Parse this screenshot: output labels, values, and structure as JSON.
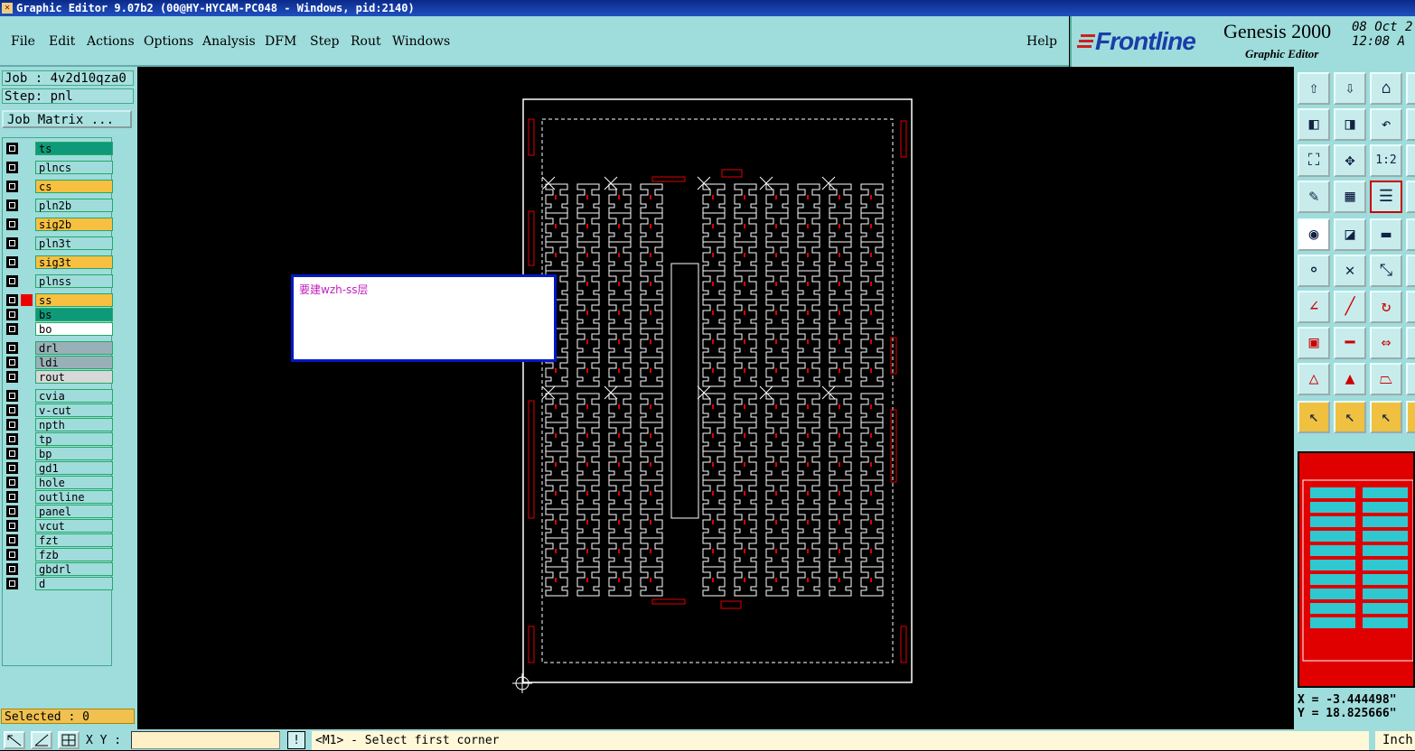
{
  "window": {
    "title": "Graphic Editor 9.07b2 (00@HY-HYCAM-PC048 - Windows, pid:2140)"
  },
  "menu": [
    "File",
    "Edit",
    "Actions",
    "Options",
    "Analysis",
    "DFM",
    "Step",
    "Rout",
    "Windows"
  ],
  "help_label": "Help",
  "brand": {
    "logo": "Frontline",
    "product": "Genesis 2000",
    "subtitle": "Graphic Editor",
    "date": "08 Oct 2",
    "time": "12:08 A"
  },
  "job": {
    "job_label": "Job : 4v2d10qza0",
    "step_label": "Step: pnl",
    "job_matrix_button": "Job Matrix ..."
  },
  "layers": [
    {
      "name": "ts",
      "color": "#0e9a78"
    },
    {
      "name": "plncs",
      "color": "#a0dcdc"
    },
    {
      "name": "cs",
      "color": "#f8c040"
    },
    {
      "name": "pln2b",
      "color": "#a0dcdc"
    },
    {
      "name": "sig2b",
      "color": "#f8c040"
    },
    {
      "name": "pln3t",
      "color": "#a0dcdc"
    },
    {
      "name": "sig3t",
      "color": "#f8c040"
    },
    {
      "name": "plnss",
      "color": "#a0dcdc"
    },
    {
      "name": "ss",
      "color": "#f8c040",
      "active": true
    },
    {
      "name": "bs",
      "color": "#0e9a78"
    },
    {
      "name": "bo",
      "color": "#ffffff"
    },
    {
      "name": "drl",
      "color": "#9ab0b8"
    },
    {
      "name": "ldi",
      "color": "#9ab0b8"
    },
    {
      "name": "rout",
      "color": "#d8d8d8"
    },
    {
      "name": "cvia",
      "color": "#a0dcdc"
    },
    {
      "name": "v-cut",
      "color": "#a0dcdc"
    },
    {
      "name": "npth",
      "color": "#a0dcdc"
    },
    {
      "name": "tp",
      "color": "#a0dcdc"
    },
    {
      "name": "bp",
      "color": "#a0dcdc"
    },
    {
      "name": "gd1",
      "color": "#a0dcdc"
    },
    {
      "name": "hole",
      "color": "#a0dcdc"
    },
    {
      "name": "outline",
      "color": "#a0dcdc"
    },
    {
      "name": "panel",
      "color": "#a0dcdc"
    },
    {
      "name": "vcut",
      "color": "#a0dcdc"
    },
    {
      "name": "fzt",
      "color": "#a0dcdc"
    },
    {
      "name": "fzb",
      "color": "#a0dcdc"
    },
    {
      "name": "gbdrl",
      "color": "#a0dcdc"
    },
    {
      "name": "d",
      "color": "#a0dcdc"
    }
  ],
  "selected_label": "Selected : 0",
  "popup": {
    "text": "要建wzh-ss层"
  },
  "toolbar_icons": [
    "home-top-icon",
    "home-bottom-icon",
    "home-icon",
    "home-right-icon",
    "pan-left-icon",
    "pan-right-icon",
    "undo-view-icon",
    "pan-right-2-icon",
    "zoom-fit-icon",
    "zoom-center-icon",
    "zoom-1-2-icon",
    "zoom-extra-icon",
    "snap-icon",
    "grid-icon",
    "layers-icon",
    "layers-extra-icon",
    "feature-info-icon",
    "measure-shape-icon",
    "ruler-icon",
    "ruler-extra-icon",
    "connect-icon",
    "delete-x-icon",
    "move-point-icon",
    "move-extra-icon",
    "line-angle-icon",
    "line-diagonal-icon",
    "arc-rotate-icon",
    "arc-extra-icon",
    "pad-add-icon",
    "line-horizontal-icon",
    "dimension-icon",
    "dimension-extra-icon",
    "triangle-add-icon",
    "triangle-outline-icon",
    "trapezoid-icon",
    "trapezoid-extra-icon",
    "select-arrow-icon",
    "select-box-icon",
    "select-highlight-icon",
    "select-extra-icon"
  ],
  "zoom_label": "1:2",
  "coords": {
    "x": "X = -3.444498\"",
    "y": "Y = 18.825666\""
  },
  "bottom": {
    "xy_label": "X Y :",
    "warn": "!",
    "prompt": "<M1> - Select first corner",
    "units": "Inch"
  },
  "colors": {
    "panel_bg": "#9fdcdc",
    "pcb_red": "#e00000",
    "pcb_white": "#ffffff",
    "thumb_cyan": "#30c8d0"
  }
}
